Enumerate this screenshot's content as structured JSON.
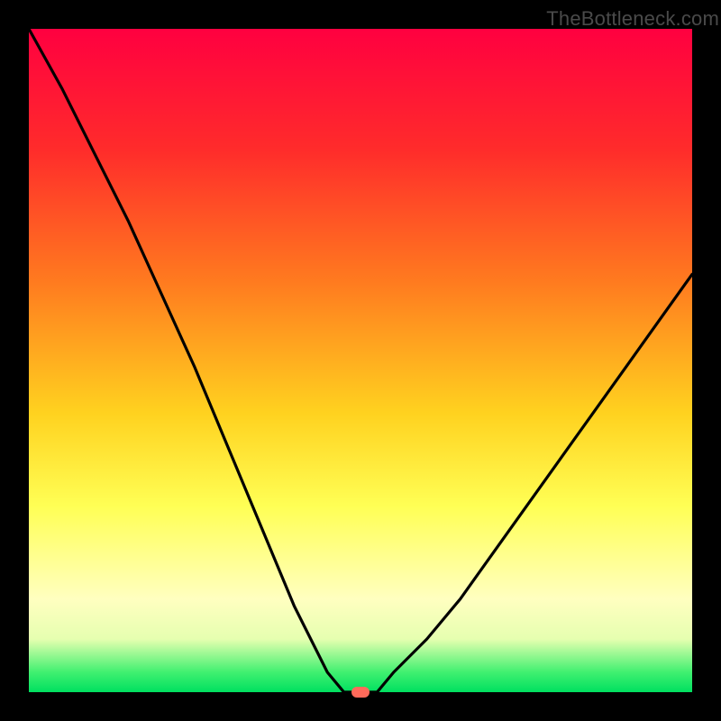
{
  "watermark": "TheBottleneck.com",
  "colors": {
    "frame": "#000000",
    "curve": "#000000",
    "marker": "#ff6a5a",
    "gradient_stops": [
      "#ff0040",
      "#ff2b2b",
      "#ff7a1f",
      "#ffd21f",
      "#ffff55",
      "#ffffc0",
      "#e6ffb0",
      "#40f070",
      "#00e060"
    ]
  },
  "chart_data": {
    "type": "line",
    "x": [
      0.0,
      0.05,
      0.1,
      0.15,
      0.2,
      0.25,
      0.3,
      0.35,
      0.4,
      0.45,
      0.475,
      0.5,
      0.525,
      0.55,
      0.6,
      0.65,
      0.7,
      0.75,
      0.8,
      0.85,
      0.9,
      0.95,
      1.0
    ],
    "values": [
      100,
      91,
      81,
      71,
      60,
      49,
      37,
      25,
      13,
      3,
      0,
      0,
      0,
      3,
      8,
      14,
      21,
      28,
      35,
      42,
      49,
      56,
      63
    ],
    "xlabel": "",
    "ylabel": "",
    "title": "",
    "ylim": [
      0,
      100
    ],
    "xlim": [
      0,
      1
    ],
    "min_point": {
      "x": 0.5,
      "y": 0
    }
  }
}
